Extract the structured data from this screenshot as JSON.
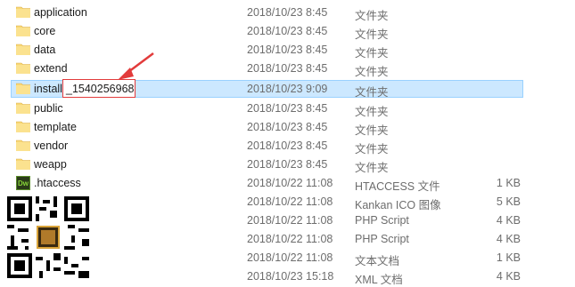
{
  "files": [
    {
      "name": "application",
      "date": "2018/10/23 8:45",
      "type": "文件夹",
      "size": "",
      "icon": "folder-icon"
    },
    {
      "name": "core",
      "date": "2018/10/23 8:45",
      "type": "文件夹",
      "size": "",
      "icon": "folder-icon"
    },
    {
      "name": "data",
      "date": "2018/10/23 8:45",
      "type": "文件夹",
      "size": "",
      "icon": "folder-icon"
    },
    {
      "name": "extend",
      "date": "2018/10/23 8:45",
      "type": "文件夹",
      "size": "",
      "icon": "folder-icon"
    },
    {
      "name": "install",
      "rename_suffix": "_1540256968",
      "date": "2018/10/23 9:09",
      "type": "文件夹",
      "size": "",
      "icon": "folder-icon"
    },
    {
      "name": "public",
      "date": "2018/10/23 8:45",
      "type": "文件夹",
      "size": "",
      "icon": "folder-icon"
    },
    {
      "name": "template",
      "date": "2018/10/23 8:45",
      "type": "文件夹",
      "size": "",
      "icon": "folder-icon"
    },
    {
      "name": "vendor",
      "date": "2018/10/23 8:45",
      "type": "文件夹",
      "size": "",
      "icon": "folder-icon"
    },
    {
      "name": "weapp",
      "date": "2018/10/23 8:45",
      "type": "文件夹",
      "size": "",
      "icon": "folder-icon"
    },
    {
      "name": ".htaccess",
      "date": "2018/10/22 11:08",
      "type": "HTACCESS 文件",
      "size": "1 KB",
      "icon": "dreamweaver-file-icon",
      "icon_text": "Dw"
    },
    {
      "name": "",
      "date": "2018/10/22 11:08",
      "type": "Kankan ICO 图像",
      "size": "5 KB",
      "icon": ""
    },
    {
      "name": "",
      "date": "2018/10/22 11:08",
      "type": "PHP Script",
      "size": "4 KB",
      "icon": ""
    },
    {
      "name": "",
      "date": "2018/10/22 11:08",
      "type": "PHP Script",
      "size": "4 KB",
      "icon": ""
    },
    {
      "name": "",
      "date": "2018/10/22 11:08",
      "type": "文本文档",
      "size": "1 KB",
      "icon": ""
    },
    {
      "name": "",
      "date": "2018/10/23 15:18",
      "type": "XML 文档",
      "size": "4 KB",
      "icon": ""
    }
  ],
  "colors": {
    "selection": "#cce8ff",
    "selection_border": "#99d1ff",
    "annotation": "#e23b3b",
    "folder": "#f8d775"
  }
}
